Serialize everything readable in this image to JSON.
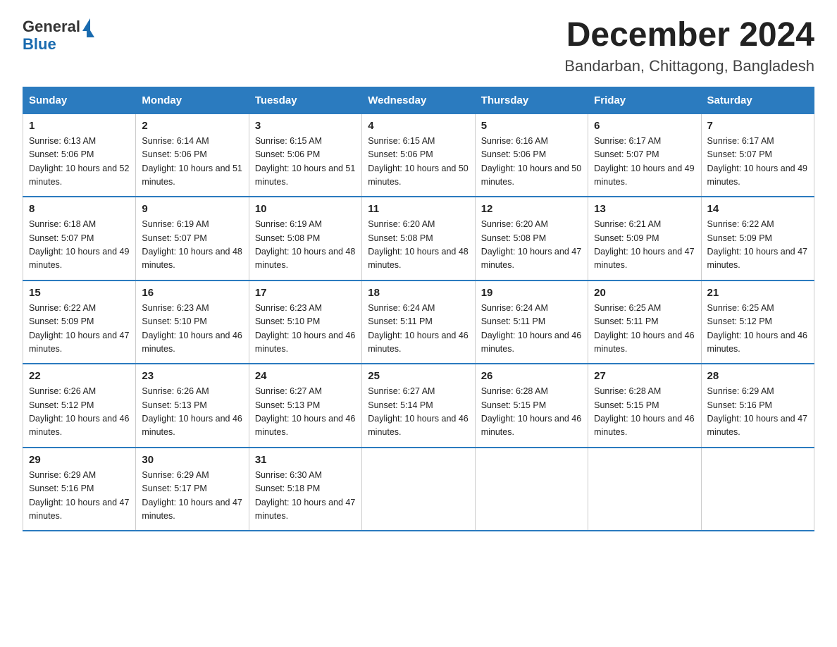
{
  "header": {
    "logo_general": "General",
    "logo_blue": "Blue",
    "month_title": "December 2024",
    "location": "Bandarban, Chittagong, Bangladesh"
  },
  "weekdays": [
    "Sunday",
    "Monday",
    "Tuesday",
    "Wednesday",
    "Thursday",
    "Friday",
    "Saturday"
  ],
  "weeks": [
    [
      {
        "day": "1",
        "sunrise": "6:13 AM",
        "sunset": "5:06 PM",
        "daylight": "10 hours and 52 minutes."
      },
      {
        "day": "2",
        "sunrise": "6:14 AM",
        "sunset": "5:06 PM",
        "daylight": "10 hours and 51 minutes."
      },
      {
        "day": "3",
        "sunrise": "6:15 AM",
        "sunset": "5:06 PM",
        "daylight": "10 hours and 51 minutes."
      },
      {
        "day": "4",
        "sunrise": "6:15 AM",
        "sunset": "5:06 PM",
        "daylight": "10 hours and 50 minutes."
      },
      {
        "day": "5",
        "sunrise": "6:16 AM",
        "sunset": "5:06 PM",
        "daylight": "10 hours and 50 minutes."
      },
      {
        "day": "6",
        "sunrise": "6:17 AM",
        "sunset": "5:07 PM",
        "daylight": "10 hours and 49 minutes."
      },
      {
        "day": "7",
        "sunrise": "6:17 AM",
        "sunset": "5:07 PM",
        "daylight": "10 hours and 49 minutes."
      }
    ],
    [
      {
        "day": "8",
        "sunrise": "6:18 AM",
        "sunset": "5:07 PM",
        "daylight": "10 hours and 49 minutes."
      },
      {
        "day": "9",
        "sunrise": "6:19 AM",
        "sunset": "5:07 PM",
        "daylight": "10 hours and 48 minutes."
      },
      {
        "day": "10",
        "sunrise": "6:19 AM",
        "sunset": "5:08 PM",
        "daylight": "10 hours and 48 minutes."
      },
      {
        "day": "11",
        "sunrise": "6:20 AM",
        "sunset": "5:08 PM",
        "daylight": "10 hours and 48 minutes."
      },
      {
        "day": "12",
        "sunrise": "6:20 AM",
        "sunset": "5:08 PM",
        "daylight": "10 hours and 47 minutes."
      },
      {
        "day": "13",
        "sunrise": "6:21 AM",
        "sunset": "5:09 PM",
        "daylight": "10 hours and 47 minutes."
      },
      {
        "day": "14",
        "sunrise": "6:22 AM",
        "sunset": "5:09 PM",
        "daylight": "10 hours and 47 minutes."
      }
    ],
    [
      {
        "day": "15",
        "sunrise": "6:22 AM",
        "sunset": "5:09 PM",
        "daylight": "10 hours and 47 minutes."
      },
      {
        "day": "16",
        "sunrise": "6:23 AM",
        "sunset": "5:10 PM",
        "daylight": "10 hours and 46 minutes."
      },
      {
        "day": "17",
        "sunrise": "6:23 AM",
        "sunset": "5:10 PM",
        "daylight": "10 hours and 46 minutes."
      },
      {
        "day": "18",
        "sunrise": "6:24 AM",
        "sunset": "5:11 PM",
        "daylight": "10 hours and 46 minutes."
      },
      {
        "day": "19",
        "sunrise": "6:24 AM",
        "sunset": "5:11 PM",
        "daylight": "10 hours and 46 minutes."
      },
      {
        "day": "20",
        "sunrise": "6:25 AM",
        "sunset": "5:11 PM",
        "daylight": "10 hours and 46 minutes."
      },
      {
        "day": "21",
        "sunrise": "6:25 AM",
        "sunset": "5:12 PM",
        "daylight": "10 hours and 46 minutes."
      }
    ],
    [
      {
        "day": "22",
        "sunrise": "6:26 AM",
        "sunset": "5:12 PM",
        "daylight": "10 hours and 46 minutes."
      },
      {
        "day": "23",
        "sunrise": "6:26 AM",
        "sunset": "5:13 PM",
        "daylight": "10 hours and 46 minutes."
      },
      {
        "day": "24",
        "sunrise": "6:27 AM",
        "sunset": "5:13 PM",
        "daylight": "10 hours and 46 minutes."
      },
      {
        "day": "25",
        "sunrise": "6:27 AM",
        "sunset": "5:14 PM",
        "daylight": "10 hours and 46 minutes."
      },
      {
        "day": "26",
        "sunrise": "6:28 AM",
        "sunset": "5:15 PM",
        "daylight": "10 hours and 46 minutes."
      },
      {
        "day": "27",
        "sunrise": "6:28 AM",
        "sunset": "5:15 PM",
        "daylight": "10 hours and 46 minutes."
      },
      {
        "day": "28",
        "sunrise": "6:29 AM",
        "sunset": "5:16 PM",
        "daylight": "10 hours and 47 minutes."
      }
    ],
    [
      {
        "day": "29",
        "sunrise": "6:29 AM",
        "sunset": "5:16 PM",
        "daylight": "10 hours and 47 minutes."
      },
      {
        "day": "30",
        "sunrise": "6:29 AM",
        "sunset": "5:17 PM",
        "daylight": "10 hours and 47 minutes."
      },
      {
        "day": "31",
        "sunrise": "6:30 AM",
        "sunset": "5:18 PM",
        "daylight": "10 hours and 47 minutes."
      },
      null,
      null,
      null,
      null
    ]
  ]
}
